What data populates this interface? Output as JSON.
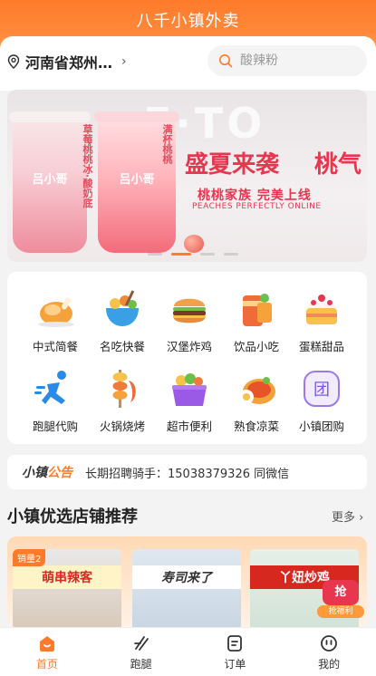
{
  "app_title": "八千小镇外卖",
  "location": {
    "text": "河南省郑州…"
  },
  "search": {
    "placeholder": "酸辣粉"
  },
  "banner": {
    "bg_word": "E·TO",
    "brand": "吕小哥",
    "cup1_text": "草莓桃桃冰·酸奶底",
    "cup2_text": "满杯桃桃",
    "headline_left": "盛夏来袭",
    "headline_right": "桃气",
    "sub": "桃桃家族  完美上线",
    "english": "PEACHES PERFECTLY ONLINE",
    "slide_count": 4,
    "active_slide": 2
  },
  "categories": [
    {
      "label": "中式简餐",
      "icon": "roast-chicken-icon",
      "color": "#f6a23a"
    },
    {
      "label": "名吃快餐",
      "icon": "food-bowl-icon",
      "color": "#3aa0e6"
    },
    {
      "label": "汉堡炸鸡",
      "icon": "burger-icon",
      "color": "#e9893a"
    },
    {
      "label": "饮品小吃",
      "icon": "drink-cup-icon",
      "color": "#f06a3a"
    },
    {
      "label": "蛋糕甜品",
      "icon": "cake-icon",
      "color": "#f6c24a"
    },
    {
      "label": "跑腿代购",
      "icon": "runner-icon",
      "color": "#2a8ae8"
    },
    {
      "label": "火锅烧烤",
      "icon": "skewer-icon",
      "color": "#f07a3a"
    },
    {
      "label": "超市便利",
      "icon": "basket-icon",
      "color": "#9b5ae6"
    },
    {
      "label": "熟食凉菜",
      "icon": "cold-dish-icon",
      "color": "#f2a23a"
    },
    {
      "label": "小镇团购",
      "icon": "group-buy-icon",
      "color": "#7a5ae6"
    }
  ],
  "notice": {
    "badge_a": "小镇",
    "badge_b": "公告",
    "text": "长期招聘骑手：15038379326 同微信"
  },
  "recommend": {
    "title": "小镇优选店铺推荐",
    "more": "更多 ›",
    "shops": [
      {
        "sign": "萌串辣客",
        "sales": "销量2"
      },
      {
        "sign": "寿司来了",
        "sales": ""
      },
      {
        "sign": "丫妞炒鸡",
        "sales": ""
      }
    ],
    "grab_button": "抢",
    "grab_tag": "抢福利"
  },
  "tabs": [
    {
      "label": "首页",
      "icon": "home-icon",
      "active": true
    },
    {
      "label": "跑腿",
      "icon": "errand-icon",
      "active": false
    },
    {
      "label": "订单",
      "icon": "order-icon",
      "active": false
    },
    {
      "label": "我的",
      "icon": "profile-icon",
      "active": false
    }
  ],
  "accent_color": "#ff7a2b"
}
